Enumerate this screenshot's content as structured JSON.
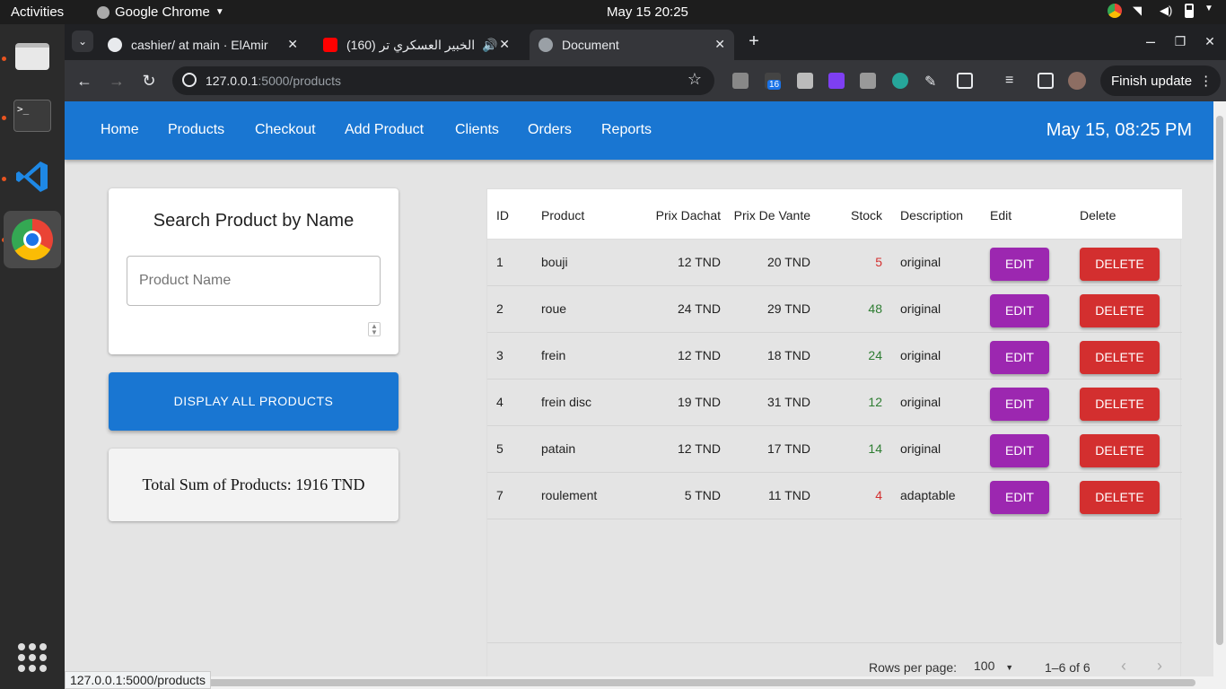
{
  "system": {
    "activities": "Activities",
    "app_name": "Google Chrome",
    "clock": "May 15  20:25"
  },
  "dock": {
    "items": [
      "files-icon",
      "terminal-icon",
      "vscode-icon",
      "chrome-icon"
    ],
    "terminal_glyph": ">_"
  },
  "browser": {
    "tabs": [
      {
        "label": "cashier/ at main · ElAmir"
      },
      {
        "label": "(160) الخبير العسكري تر"
      },
      {
        "label": "Document"
      }
    ],
    "url_host": "127.0.0.1",
    "url_path": ":5000/products",
    "finish_update": "Finish update",
    "ext_badge": "16",
    "status_url": "127.0.0.1:5000/products"
  },
  "app": {
    "nav": [
      "Home",
      "Products",
      "Checkout",
      "Add Product",
      "Clients",
      "Orders",
      "Reports"
    ],
    "date": "May 15, 08:25 PM",
    "search": {
      "title": "Search Product by Name",
      "placeholder": "Product Name"
    },
    "display_all": "DISPLAY ALL PRODUCTS",
    "total_sum": "Total Sum of Products: 1916 TND",
    "table": {
      "headers": [
        "ID",
        "Product",
        "Prix Dachat",
        "Prix De Vante",
        "Stock",
        "Description",
        "Edit",
        "Delete"
      ],
      "rows": [
        {
          "id": "1",
          "product": "bouji",
          "buy": "12 TND",
          "sell": "20 TND",
          "stock": "5",
          "stock_color": "#d32f2f",
          "desc": "original"
        },
        {
          "id": "2",
          "product": "roue",
          "buy": "24 TND",
          "sell": "29 TND",
          "stock": "48",
          "stock_color": "#2e7d32",
          "desc": "original"
        },
        {
          "id": "3",
          "product": "frein",
          "buy": "12 TND",
          "sell": "18 TND",
          "stock": "24",
          "stock_color": "#2e7d32",
          "desc": "original"
        },
        {
          "id": "4",
          "product": "frein disc",
          "buy": "19 TND",
          "sell": "31 TND",
          "stock": "12",
          "stock_color": "#2e7d32",
          "desc": "original"
        },
        {
          "id": "5",
          "product": "patain",
          "buy": "12 TND",
          "sell": "17 TND",
          "stock": "14",
          "stock_color": "#2e7d32",
          "desc": "original"
        },
        {
          "id": "7",
          "product": "roulement",
          "buy": "5 TND",
          "sell": "11 TND",
          "stock": "4",
          "stock_color": "#d32f2f",
          "desc": "adaptable"
        }
      ],
      "edit_label": "EDIT",
      "delete_label": "DELETE",
      "rows_per_page_label": "Rows per page:",
      "rows_per_page_value": "100",
      "range": "1–6 of 6"
    }
  },
  "colors": {
    "appbar": "#1976d2",
    "edit": "#9c27b0",
    "delete": "#d32f2f"
  }
}
